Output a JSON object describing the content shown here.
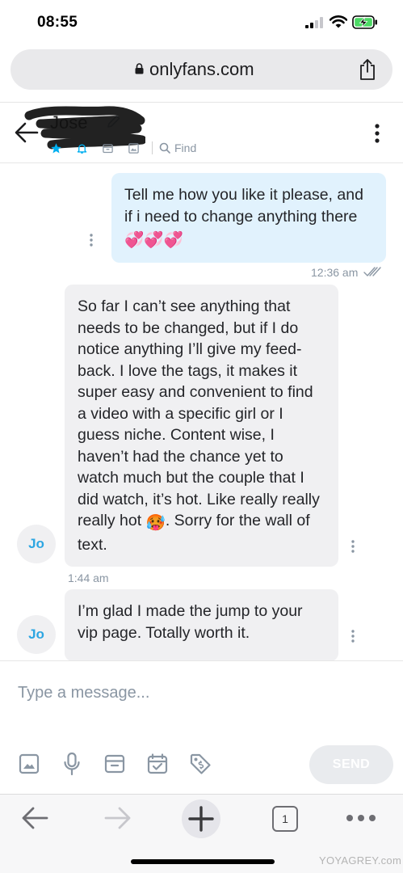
{
  "status_bar": {
    "time": "08:55"
  },
  "browser": {
    "url": "onlyfans.com",
    "tab_count": "1"
  },
  "chat": {
    "contact_name": "Jose",
    "find_label": "Find",
    "messages": [
      {
        "direction": "outgoing",
        "text": "Tell me how you like it please, and if i need to change anything there",
        "emoji": "💞💞💞",
        "time": "12:36 am"
      },
      {
        "direction": "incoming",
        "avatar": "Jo",
        "text": "So far I can’t see anything that needs to be changed, but if I do notice anything I’ll give my feed-back. I love the tags, it makes it super easy and convenient to find a video with a specific girl or I guess niche. Content wise, I haven’t had the chance yet to watch much but the couple that I did watch, it’s hot. Like really really really hot",
        "emoji": "🥵",
        "text_after": ". Sorry for the wall of text.",
        "time": "1:44 am"
      },
      {
        "direction": "incoming",
        "avatar": "Jo",
        "text": "I’m glad I made the jump to your vip page. Totally worth it."
      }
    ]
  },
  "composer": {
    "placeholder": "Type a message...",
    "send_label": "SEND"
  },
  "watermark": "YOYAGREY.com",
  "colors": {
    "accent": "#00aff0",
    "outgoing_bubble": "#e1f2fd",
    "incoming_bubble": "#f0f0f2",
    "muted": "#8a96a3"
  }
}
